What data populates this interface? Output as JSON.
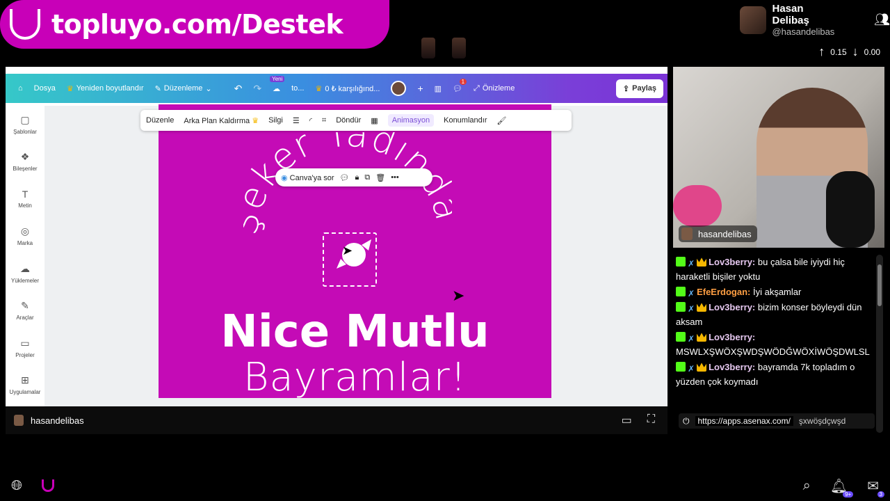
{
  "promo": {
    "text": "topluyo.com/Destek"
  },
  "streamer": {
    "name": "Hasan Delibaş",
    "handle": "@hasandelibas"
  },
  "stats": {
    "up": "0.15",
    "down": "0.00"
  },
  "canva": {
    "topbar": {
      "dosya": "Dosya",
      "resize": "Yeniden boyutlandır",
      "edit": "Düzenleme",
      "new_badge": "Yeni",
      "project": "to...",
      "credit": "0 ₺ karşılığınd...",
      "notif_count": "1",
      "preview": "Önizleme",
      "share": "Paylaş"
    },
    "toolbar": {
      "edit": "Düzenle",
      "bg_remove": "Arka Plan Kaldırma",
      "eraser": "Silgi",
      "rotate": "Döndür",
      "animation": "Animasyon",
      "position": "Konumlandır"
    },
    "sidebar": [
      {
        "label": "Şablonlar",
        "icon": "templates-icon",
        "glyph": "▢"
      },
      {
        "label": "Bileşenler",
        "icon": "elements-icon",
        "glyph": "❖"
      },
      {
        "label": "Metin",
        "icon": "text-icon",
        "glyph": "T"
      },
      {
        "label": "Marka",
        "icon": "brand-icon",
        "glyph": "◎"
      },
      {
        "label": "Yüklemeler",
        "icon": "upload-icon",
        "glyph": "☁"
      },
      {
        "label": "Araçlar",
        "icon": "tools-icon",
        "glyph": "✎"
      },
      {
        "label": "Projeler",
        "icon": "folder-icon",
        "glyph": "▭"
      },
      {
        "label": "Uygulamalar",
        "icon": "apps-icon",
        "glyph": "⊞"
      }
    ],
    "context": {
      "ask": "Canva'ya sor"
    },
    "design": {
      "arc_text": "Şeker Tadında",
      "line1": "Nice Mutlu",
      "line2": "Bayramlar!"
    }
  },
  "screen_owner": "hasandelibas",
  "cam_owner": "hasandelibas",
  "chat": [
    {
      "user": "Lov3berry:",
      "color": "#e6c8f0",
      "text": "bu çalsa bile iyiydi hiç haraketli bişiler yoktu"
    },
    {
      "user": "EfeErdogan:",
      "color": "#ff9f43",
      "text": "İyi akşamlar"
    },
    {
      "user": "Lov3berry:",
      "color": "#e6c8f0",
      "text": "bizim konser böyleydi dün aksam"
    },
    {
      "user": "Lov3berry:",
      "color": "#e6c8f0",
      "text": "MSWLXŞWÖXŞWDŞWÖDĞWÖXİWÖŞDWLSL"
    },
    {
      "user": "Lov3berry:",
      "color": "#e6c8f0",
      "text": "bayramda 7k topladım o yüzden çok koymadı"
    }
  ],
  "chat_link": {
    "url": "https://apps.asenax.com/",
    "tail": "şxwöşdçwşd"
  },
  "bottom": {
    "bell_count": "9+",
    "mail_count": "3"
  },
  "colors": {
    "brand": "#c800b8",
    "design_bg": "#c40bb6",
    "kick_green": "#53fc18"
  }
}
